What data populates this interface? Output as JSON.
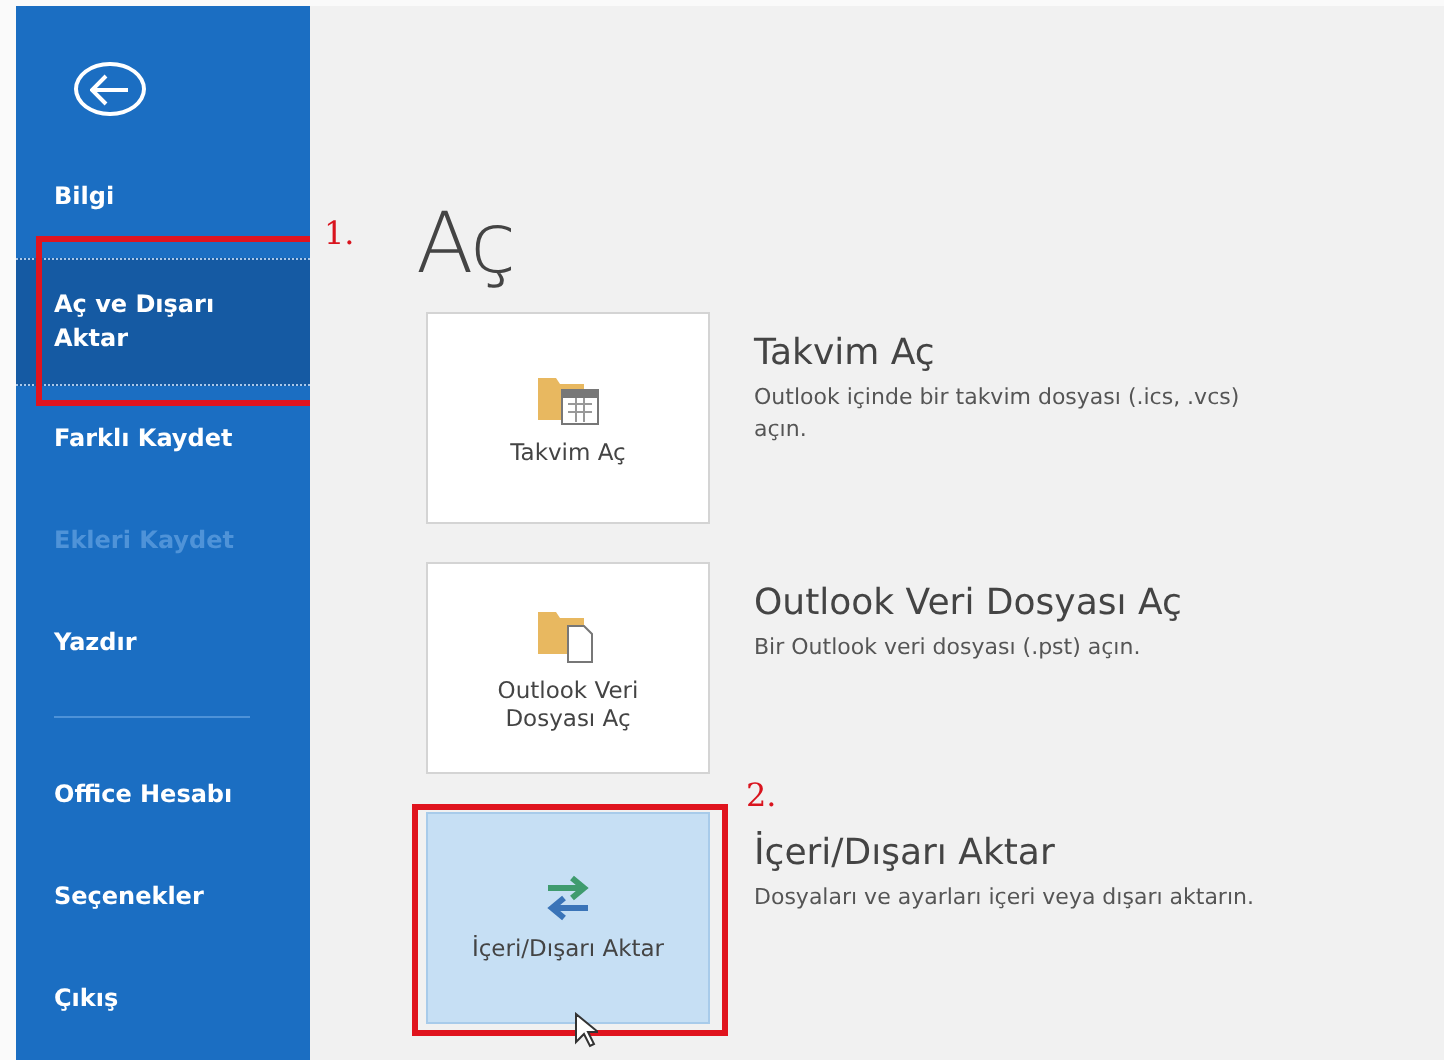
{
  "sidebar": {
    "items": [
      {
        "label": "Bilgi",
        "selected": false,
        "disabled": false,
        "marked": false
      },
      {
        "label": "Aç ve Dışarı Aktar",
        "selected": true,
        "disabled": false,
        "marked": true
      },
      {
        "label": "Farklı Kaydet",
        "selected": false,
        "disabled": false,
        "marked": false
      },
      {
        "label": "Ekleri Kaydet",
        "selected": false,
        "disabled": true,
        "marked": false
      },
      {
        "label": "Yazdır",
        "selected": false,
        "disabled": false,
        "marked": false
      },
      {
        "kind": "divider"
      },
      {
        "label": "Office Hesabı",
        "selected": false,
        "disabled": false,
        "marked": false
      },
      {
        "label": "Seçenekler",
        "selected": false,
        "disabled": false,
        "marked": false
      },
      {
        "label": "Çıkış",
        "selected": false,
        "disabled": false,
        "marked": false
      }
    ]
  },
  "step_labels": [
    "1.",
    "2."
  ],
  "title": "Aç",
  "options": [
    {
      "tile_label": "Takvim Aç",
      "heading": "Takvim Aç",
      "description": "Outlook içinde bir takvim dosyası (.ics, .vcs) açın.",
      "selected": false,
      "marked": false
    },
    {
      "tile_label": "Outlook Veri Dosyası Aç",
      "heading": "Outlook Veri Dosyası Aç",
      "description": "Bir Outlook veri dosyası (.pst) açın.",
      "selected": false,
      "marked": false
    },
    {
      "tile_label": "İçeri/Dışarı Aktar",
      "heading": "İçeri/Dışarı Aktar",
      "description": "Dosyaları ve ayarları içeri veya dışarı aktarın.",
      "selected": true,
      "marked": true
    }
  ]
}
